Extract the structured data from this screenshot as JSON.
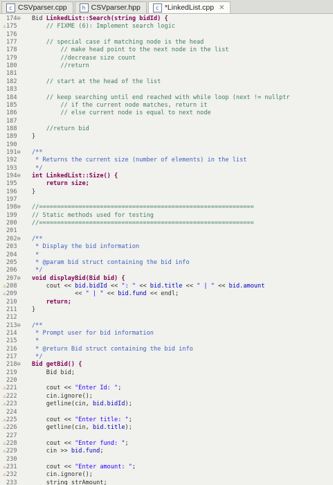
{
  "tabs": [
    {
      "label": "CSVparser.cpp",
      "icon": "c-file-icon",
      "active": false
    },
    {
      "label": "CSVparser.hpp",
      "icon": "h-file-icon",
      "active": false
    },
    {
      "label": "*LinkedList.cpp",
      "icon": "c-file-icon",
      "active": true,
      "close": "✕"
    }
  ],
  "lines": [
    {
      "n": "174⊖",
      "m": "",
      "segs": [
        {
          "c": "plain",
          "t": "Bid "
        },
        {
          "c": "kw",
          "t": "LinkedList::Search("
        },
        {
          "c": "kw",
          "t": "string"
        },
        {
          "c": "kw",
          "t": " bidId) {"
        }
      ],
      "indent": ""
    },
    {
      "n": "175",
      "m": "warn",
      "segs": [
        {
          "c": "cm",
          "t": "// FIXME (6): Implement search logic"
        }
      ],
      "indent": "    "
    },
    {
      "n": "176",
      "m": "",
      "segs": [],
      "indent": ""
    },
    {
      "n": "177",
      "m": "",
      "segs": [
        {
          "c": "cm",
          "t": "// special case if matching node is the head"
        }
      ],
      "indent": "    "
    },
    {
      "n": "178",
      "m": "",
      "segs": [
        {
          "c": "cm",
          "t": "// make head point to the next node in the list"
        }
      ],
      "indent": "        "
    },
    {
      "n": "179",
      "m": "",
      "segs": [
        {
          "c": "cm",
          "t": "//decrease size count"
        }
      ],
      "indent": "        "
    },
    {
      "n": "180",
      "m": "",
      "segs": [
        {
          "c": "cm",
          "t": "//return"
        }
      ],
      "indent": "        "
    },
    {
      "n": "181",
      "m": "",
      "segs": [],
      "indent": ""
    },
    {
      "n": "182",
      "m": "",
      "segs": [
        {
          "c": "cm",
          "t": "// start at the head of the list"
        }
      ],
      "indent": "    "
    },
    {
      "n": "183",
      "m": "",
      "segs": [],
      "indent": ""
    },
    {
      "n": "184",
      "m": "",
      "segs": [
        {
          "c": "cm",
          "t": "// keep searching until end reached with while loop (next != nullptr"
        }
      ],
      "indent": "    "
    },
    {
      "n": "185",
      "m": "",
      "segs": [
        {
          "c": "cm",
          "t": "// if the current node matches, return it"
        }
      ],
      "indent": "        "
    },
    {
      "n": "186",
      "m": "",
      "segs": [
        {
          "c": "cm",
          "t": "// else current node is equal to next node"
        }
      ],
      "indent": "        "
    },
    {
      "n": "187",
      "m": "",
      "segs": [],
      "indent": ""
    },
    {
      "n": "188",
      "m": "",
      "segs": [
        {
          "c": "cm",
          "t": "//return bid"
        }
      ],
      "indent": "    "
    },
    {
      "n": "189",
      "m": "",
      "segs": [
        {
          "c": "plain",
          "t": "}"
        }
      ],
      "indent": ""
    },
    {
      "n": "190",
      "m": "",
      "segs": [],
      "indent": ""
    },
    {
      "n": "191⊖",
      "m": "",
      "segs": [
        {
          "c": "doc",
          "t": "/**"
        }
      ],
      "indent": ""
    },
    {
      "n": "192",
      "m": "",
      "segs": [
        {
          "c": "doc",
          "t": " * Returns the current size (number of elements) in the list"
        }
      ],
      "indent": ""
    },
    {
      "n": "193",
      "m": "",
      "segs": [
        {
          "c": "doc",
          "t": " */"
        }
      ],
      "indent": ""
    },
    {
      "n": "194⊖",
      "m": "",
      "segs": [
        {
          "c": "kw",
          "t": "int"
        },
        {
          "c": "kw",
          "t": " LinkedList::Size() {"
        }
      ],
      "indent": ""
    },
    {
      "n": "195",
      "m": "",
      "segs": [
        {
          "c": "kw",
          "t": "return"
        },
        {
          "c": "kw",
          "t": " size;"
        }
      ],
      "indent": "    "
    },
    {
      "n": "196",
      "m": "",
      "segs": [
        {
          "c": "plain",
          "t": "}"
        }
      ],
      "indent": ""
    },
    {
      "n": "197",
      "m": "",
      "segs": [],
      "indent": ""
    },
    {
      "n": "198⊖",
      "m": "",
      "segs": [
        {
          "c": "cm",
          "t": "//============================================================"
        }
      ],
      "indent": ""
    },
    {
      "n": "199",
      "m": "",
      "segs": [
        {
          "c": "cm",
          "t": "// Static methods used for testing"
        }
      ],
      "indent": ""
    },
    {
      "n": "200",
      "m": "",
      "segs": [
        {
          "c": "cm",
          "t": "//============================================================"
        }
      ],
      "indent": ""
    },
    {
      "n": "201",
      "m": "",
      "segs": [],
      "indent": ""
    },
    {
      "n": "202⊖",
      "m": "",
      "segs": [
        {
          "c": "doc",
          "t": "/**"
        }
      ],
      "indent": ""
    },
    {
      "n": "203",
      "m": "",
      "segs": [
        {
          "c": "doc",
          "t": " * Display the bid information"
        }
      ],
      "indent": ""
    },
    {
      "n": "204",
      "m": "",
      "segs": [
        {
          "c": "doc",
          "t": " *"
        }
      ],
      "indent": ""
    },
    {
      "n": "205",
      "m": "",
      "segs": [
        {
          "c": "doc",
          "t": " * @param bid struct containing the bid info"
        }
      ],
      "indent": ""
    },
    {
      "n": "206",
      "m": "",
      "segs": [
        {
          "c": "doc",
          "t": " */"
        }
      ],
      "indent": ""
    },
    {
      "n": "207⊖",
      "m": "",
      "segs": [
        {
          "c": "kw",
          "t": "void"
        },
        {
          "c": "kw",
          "t": " displayBid(Bid bid) {"
        }
      ],
      "indent": ""
    },
    {
      "n": "208",
      "m": "warn",
      "segs": [
        {
          "c": "plain",
          "t": "cout << "
        },
        {
          "c": "fld",
          "t": "bid.bidId"
        },
        {
          "c": "plain",
          "t": " << "
        },
        {
          "c": "str",
          "t": "\": \""
        },
        {
          "c": "plain",
          "t": " << "
        },
        {
          "c": "fld",
          "t": "bid.title"
        },
        {
          "c": "plain",
          "t": " << "
        },
        {
          "c": "str",
          "t": "\" | \""
        },
        {
          "c": "plain",
          "t": " << "
        },
        {
          "c": "fld",
          "t": "bid.amount"
        }
      ],
      "indent": "    "
    },
    {
      "n": "209",
      "m": "warn",
      "segs": [
        {
          "c": "plain",
          "t": "<< "
        },
        {
          "c": "str",
          "t": "\" | \""
        },
        {
          "c": "plain",
          "t": " << "
        },
        {
          "c": "fld",
          "t": "bid.fund"
        },
        {
          "c": "plain",
          "t": " << endl;"
        }
      ],
      "indent": "            "
    },
    {
      "n": "210",
      "m": "",
      "segs": [
        {
          "c": "kw",
          "t": "return;"
        }
      ],
      "indent": "    "
    },
    {
      "n": "211",
      "m": "",
      "segs": [
        {
          "c": "plain",
          "t": "}"
        }
      ],
      "indent": ""
    },
    {
      "n": "212",
      "m": "",
      "segs": [],
      "indent": ""
    },
    {
      "n": "213⊖",
      "m": "",
      "segs": [
        {
          "c": "doc",
          "t": "/**"
        }
      ],
      "indent": ""
    },
    {
      "n": "214",
      "m": "",
      "segs": [
        {
          "c": "doc",
          "t": " * Prompt user for bid information"
        }
      ],
      "indent": ""
    },
    {
      "n": "215",
      "m": "",
      "segs": [
        {
          "c": "doc",
          "t": " *"
        }
      ],
      "indent": ""
    },
    {
      "n": "216",
      "m": "",
      "segs": [
        {
          "c": "doc",
          "t": " * @return Bid struct containing the bid info"
        }
      ],
      "indent": ""
    },
    {
      "n": "217",
      "m": "",
      "segs": [
        {
          "c": "doc",
          "t": " */"
        }
      ],
      "indent": ""
    },
    {
      "n": "218⊖",
      "m": "",
      "segs": [
        {
          "c": "kw",
          "t": "Bid getBid() {"
        }
      ],
      "indent": ""
    },
    {
      "n": "219",
      "m": "",
      "segs": [
        {
          "c": "plain",
          "t": "Bid bid;"
        }
      ],
      "indent": "    "
    },
    {
      "n": "220",
      "m": "",
      "segs": [],
      "indent": ""
    },
    {
      "n": "221",
      "m": "warn",
      "segs": [
        {
          "c": "plain",
          "t": "cout << "
        },
        {
          "c": "str",
          "t": "\"Enter Id: \""
        },
        {
          "c": "plain",
          "t": ";"
        }
      ],
      "indent": "    "
    },
    {
      "n": "222",
      "m": "warn",
      "segs": [
        {
          "c": "plain",
          "t": "cin.ignore();"
        }
      ],
      "indent": "    "
    },
    {
      "n": "223",
      "m": "warn",
      "segs": [
        {
          "c": "plain",
          "t": "getline(cin, "
        },
        {
          "c": "fld",
          "t": "bid.bidId"
        },
        {
          "c": "plain",
          "t": ");"
        }
      ],
      "indent": "    "
    },
    {
      "n": "224",
      "m": "",
      "segs": [],
      "indent": ""
    },
    {
      "n": "225",
      "m": "warn",
      "segs": [
        {
          "c": "plain",
          "t": "cout << "
        },
        {
          "c": "str",
          "t": "\"Enter title: \""
        },
        {
          "c": "plain",
          "t": ";"
        }
      ],
      "indent": "    "
    },
    {
      "n": "226",
      "m": "warn",
      "segs": [
        {
          "c": "plain",
          "t": "getline(cin, "
        },
        {
          "c": "fld",
          "t": "bid.title"
        },
        {
          "c": "plain",
          "t": ");"
        }
      ],
      "indent": "    "
    },
    {
      "n": "227",
      "m": "",
      "segs": [],
      "indent": ""
    },
    {
      "n": "228",
      "m": "warn",
      "segs": [
        {
          "c": "plain",
          "t": "cout << "
        },
        {
          "c": "str",
          "t": "\"Enter fund: \""
        },
        {
          "c": "plain",
          "t": ";"
        }
      ],
      "indent": "    "
    },
    {
      "n": "229",
      "m": "warn",
      "segs": [
        {
          "c": "plain",
          "t": "cin >> "
        },
        {
          "c": "fld",
          "t": "bid.fund"
        },
        {
          "c": "plain",
          "t": ";"
        }
      ],
      "indent": "    "
    },
    {
      "n": "230",
      "m": "",
      "segs": [],
      "indent": ""
    },
    {
      "n": "231",
      "m": "warn",
      "segs": [
        {
          "c": "plain",
          "t": "cout << "
        },
        {
          "c": "str",
          "t": "\"Enter amount: \""
        },
        {
          "c": "plain",
          "t": ";"
        }
      ],
      "indent": "    "
    },
    {
      "n": "232",
      "m": "warn",
      "segs": [
        {
          "c": "plain",
          "t": "cin.ignore();"
        }
      ],
      "indent": "    "
    },
    {
      "n": "233",
      "m": "",
      "segs": [
        {
          "c": "plain",
          "t": "string strAmount;"
        }
      ],
      "indent": "    "
    }
  ]
}
